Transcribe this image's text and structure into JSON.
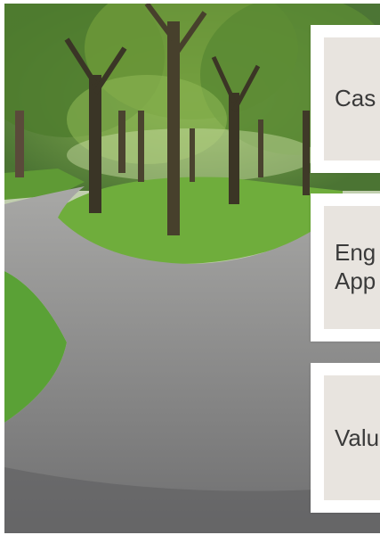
{
  "slide": {
    "photo_description_icon": "park-path-fork-image",
    "cards": [
      {
        "label": "Cas"
      },
      {
        "label_line1": "Eng",
        "label_line2": "App"
      },
      {
        "label": "Valu"
      }
    ]
  },
  "colors": {
    "card_bg": "#ffffff",
    "card_inner": "#e8e4df",
    "text": "#3a3a3a"
  }
}
